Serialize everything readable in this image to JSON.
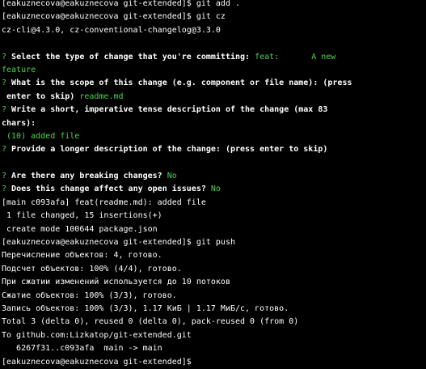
{
  "terminal": {
    "prompt": "[eakuznecova@eakuznecova git-extended]$",
    "cmd_add": " git add .",
    "cmd_cz": " git cz",
    "cz_versions": "cz-cli@4.3.0, cz-conventional-changelog@3.3.0",
    "q_mark": "?",
    "q_type": " Select the type of change that you're committing:",
    "ans_type": " feat:",
    "ans_type_desc": "A new",
    "ans_type_desc_cont": "feature",
    "q_scope_1": " What is the scope of this change (e.g. component or file name): (press",
    "q_scope_2": " enter to skip)",
    "ans_scope": " readme.md",
    "q_short_1": " Write a short, imperative tense description of the change (max 83",
    "q_short_2": "chars):",
    "ans_short": " (10) added file",
    "q_long": " Provide a longer description of the change: (press enter to skip)",
    "q_breaking": " Are there any breaking changes?",
    "ans_breaking": " No",
    "q_issues": " Does this change affect any open issues?",
    "ans_issues": " No",
    "commit_line": "[main c093afa] feat(readme.md): added file",
    "changed_line": " 1 file changed, 15 insertions(+)",
    "create_line": " create mode 100644 package.json",
    "cmd_push": " git push",
    "push_lines": [
      "Перечисление объектов: 4, готово.",
      "Подсчет объектов: 100% (4/4), готово.",
      "При сжатии изменений используется до 10 потоков",
      "Сжатие объектов: 100% (3/3), готово.",
      "Запись объектов: 100% (3/3), 1.17 КиБ | 1.17 МиБ/с, готово.",
      "Total 3 (delta 0), reused 0 (delta 0), pack-reused 0 (from 0)",
      "To github.com:Lizkatop/git-extended.git",
      "   6267f31..c093afa  main -> main"
    ]
  },
  "colors": {
    "background": "#000000",
    "text": "#ffffff",
    "accent_green": "#4fd44f"
  }
}
